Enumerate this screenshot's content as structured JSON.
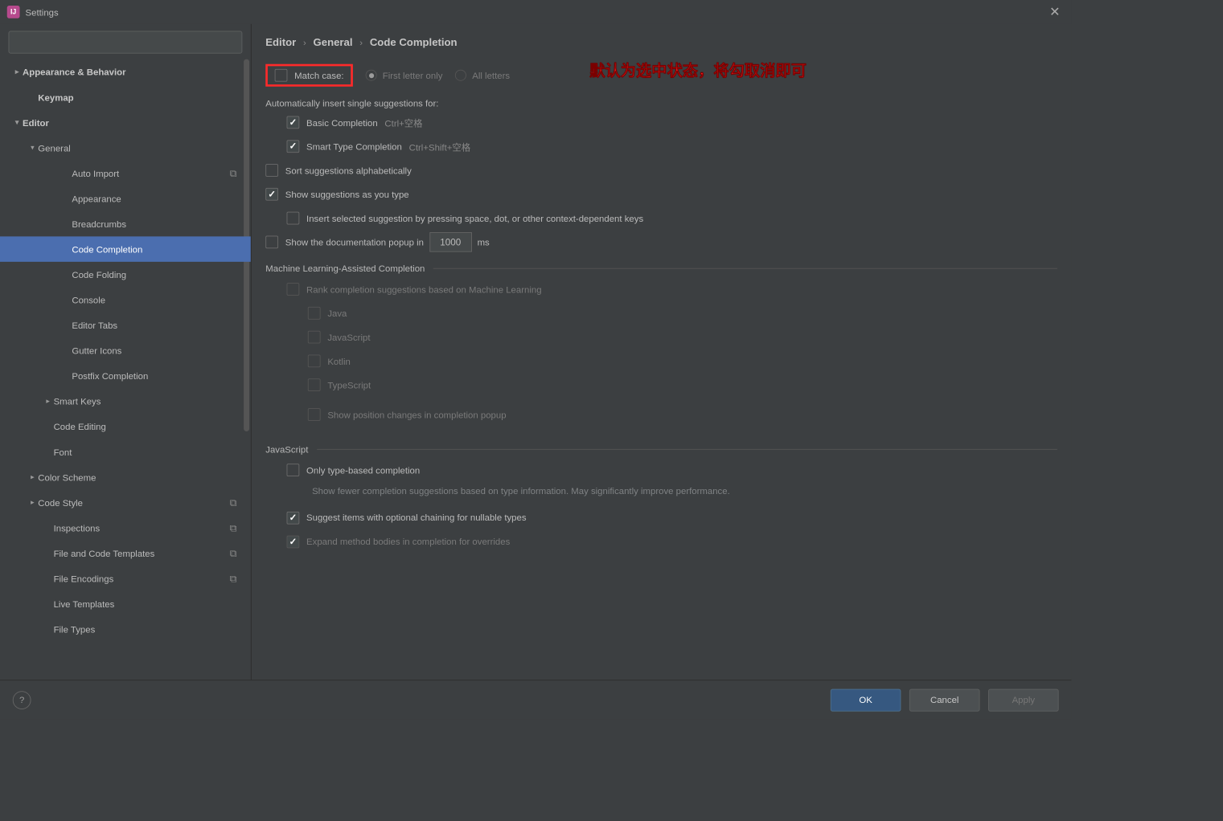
{
  "window": {
    "title": "Settings"
  },
  "search": {
    "placeholder": ""
  },
  "annotation": "默认为选中状态，将勾取消即可",
  "sidebar": {
    "items": [
      {
        "label": "Appearance & Behavior",
        "arrow": "right",
        "bold": true,
        "indent": 0
      },
      {
        "label": "Keymap",
        "bold": true,
        "indent": 1
      },
      {
        "label": "Editor",
        "arrow": "down",
        "bold": true,
        "indent": 0
      },
      {
        "label": "General",
        "arrow": "down",
        "indent": 1
      },
      {
        "label": "Auto Import",
        "indent": 3,
        "overlay": true
      },
      {
        "label": "Appearance",
        "indent": 3
      },
      {
        "label": "Breadcrumbs",
        "indent": 3
      },
      {
        "label": "Code Completion",
        "indent": 3,
        "selected": true
      },
      {
        "label": "Code Folding",
        "indent": 3
      },
      {
        "label": "Console",
        "indent": 3
      },
      {
        "label": "Editor Tabs",
        "indent": 3
      },
      {
        "label": "Gutter Icons",
        "indent": 3
      },
      {
        "label": "Postfix Completion",
        "indent": 3
      },
      {
        "label": "Smart Keys",
        "arrow": "right",
        "indent": 2
      },
      {
        "label": "Code Editing",
        "indent": 2
      },
      {
        "label": "Font",
        "indent": 2
      },
      {
        "label": "Color Scheme",
        "arrow": "right",
        "indent": 1
      },
      {
        "label": "Code Style",
        "arrow": "right",
        "indent": 1,
        "overlay": true
      },
      {
        "label": "Inspections",
        "indent": 2,
        "overlay": true
      },
      {
        "label": "File and Code Templates",
        "indent": 2,
        "overlay": true
      },
      {
        "label": "File Encodings",
        "indent": 2,
        "overlay": true
      },
      {
        "label": "Live Templates",
        "indent": 2
      },
      {
        "label": "File Types",
        "indent": 2
      }
    ]
  },
  "breadcrumb": {
    "a": "Editor",
    "b": "General",
    "c": "Code Completion"
  },
  "panel": {
    "matchCase": "Match case:",
    "firstLetter": "First letter only",
    "allLetters": "All letters",
    "autoInsertHeading": "Automatically insert single suggestions for:",
    "basicCompletion": "Basic Completion",
    "basicSC": "Ctrl+空格",
    "smartType": "Smart Type Completion",
    "smartSC": "Ctrl+Shift+空格",
    "sortAlpha": "Sort suggestions alphabetically",
    "showAsType": "Show suggestions as you type",
    "insertSelected": "Insert selected suggestion by pressing space, dot, or other context-dependent keys",
    "showDocPre": "Show the documentation popup in",
    "docMs": "1000",
    "msLabel": "ms",
    "mlHeading": "Machine Learning-Assisted Completion",
    "rankML": "Rank completion suggestions based on Machine Learning",
    "langJava": "Java",
    "langJS": "JavaScript",
    "langKotlin": "Kotlin",
    "langTS": "TypeScript",
    "showPos": "Show position changes in completion popup",
    "jsHeading": "JavaScript",
    "onlyType": "Only type-based completion",
    "onlyTypeHint": "Show fewer completion suggestions based on type information. May significantly improve performance.",
    "suggestOpt": "Suggest items with optional chaining for nullable types",
    "expandMethod": "Expand method bodies in completion for overrides"
  },
  "footer": {
    "ok": "OK",
    "cancel": "Cancel",
    "apply": "Apply"
  }
}
